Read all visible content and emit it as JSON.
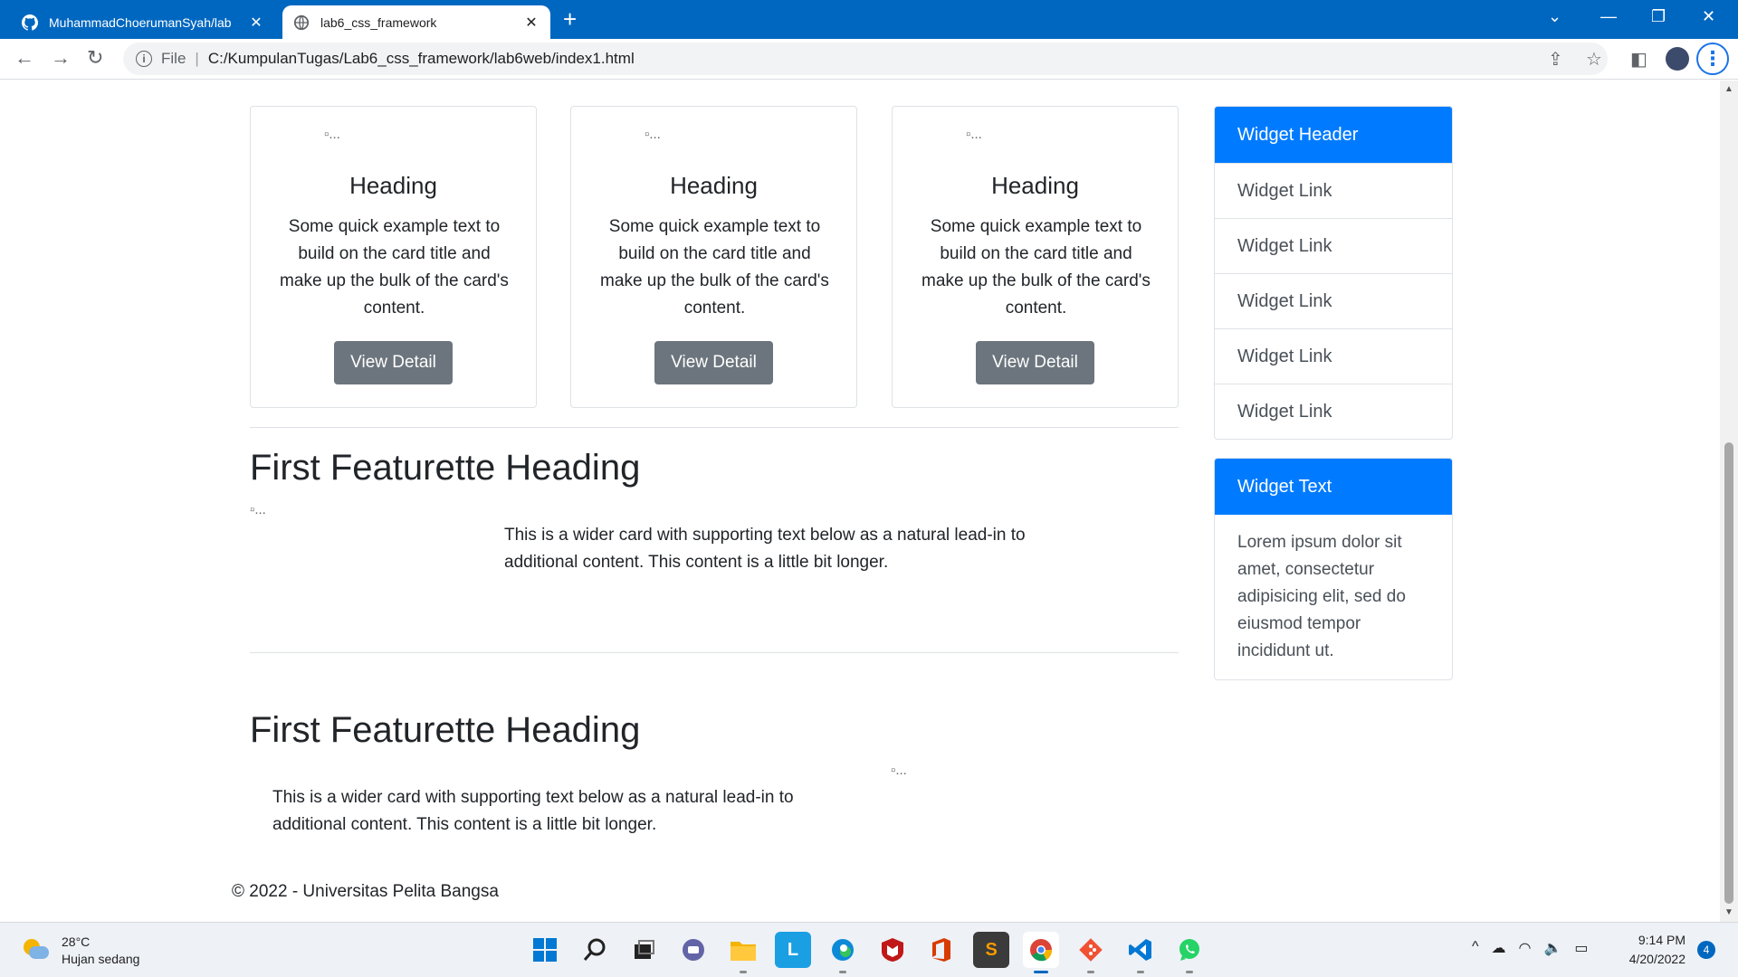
{
  "browser": {
    "tabs": [
      {
        "title": "MuhammadChoerumanSyah/lab",
        "active": false
      },
      {
        "title": "lab6_css_framework",
        "active": true
      }
    ],
    "address": {
      "scheme": "File",
      "url": "C:/KumpulanTugas/Lab6_css_framework/lab6web/index1.html"
    },
    "window_controls": {
      "minimize": "—",
      "restore": "❐",
      "close": "✕"
    },
    "new_tab": "+"
  },
  "page": {
    "cards": [
      {
        "img_alt": "...",
        "heading": "Heading",
        "text": "Some quick example text to build on the card title and make up the bulk of the card's content.",
        "button": "View Detail"
      },
      {
        "img_alt": "...",
        "heading": "Heading",
        "text": "Some quick example text to build on the card title and make up the bulk of the card's content.",
        "button": "View Detail"
      },
      {
        "img_alt": "...",
        "heading": "Heading",
        "text": "Some quick example text to build on the card title and make up the bulk of the card's content.",
        "button": "View Detail"
      }
    ],
    "featurettes": [
      {
        "heading": "First Featurette Heading",
        "img_alt": "...",
        "text": "This is a wider card with supporting text below as a natural lead-in to additional content. This content is a little bit longer."
      },
      {
        "heading": "First Featurette Heading",
        "img_alt": "...",
        "text": "This is a wider card with supporting text below as a natural lead-in to additional content. This content is a little bit longer."
      }
    ],
    "widget_links": {
      "header": "Widget Header",
      "links": [
        "Widget Link",
        "Widget Link",
        "Widget Link",
        "Widget Link",
        "Widget Link"
      ]
    },
    "widget_text": {
      "header": "Widget Text",
      "body": "Lorem ipsum dolor sit amet, consectetur adipisicing elit, sed do eiusmod tempor incididunt ut."
    },
    "footer": "© 2022 - Universitas Pelita Bangsa"
  },
  "taskbar": {
    "weather": {
      "temp": "28°C",
      "condition": "Hujan sedang"
    },
    "clock": {
      "time": "9:14 PM",
      "date": "4/20/2022"
    },
    "notifications": "4",
    "apps": [
      "windows-start",
      "search",
      "task-view",
      "teams-chat",
      "file-explorer",
      "l-app",
      "edge",
      "mcafee",
      "office",
      "sublime-text",
      "chrome",
      "git",
      "vscode",
      "whatsapp"
    ]
  }
}
